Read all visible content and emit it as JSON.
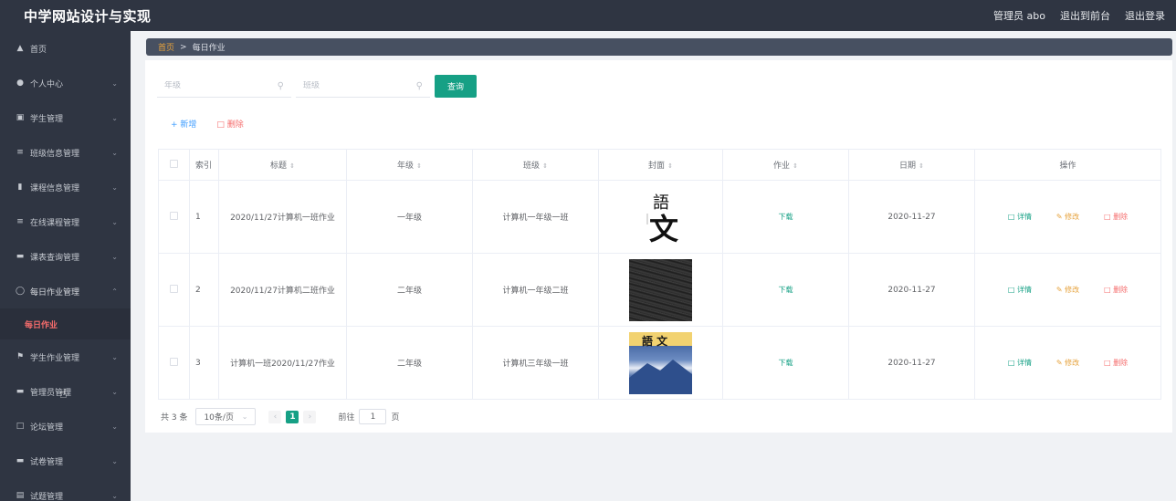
{
  "app": {
    "title": "中学网站设计与实现"
  },
  "header": {
    "user": "管理员 abo",
    "frontend": "退出到前台",
    "logout": "退出登录"
  },
  "sidebar": {
    "items": [
      {
        "label": "首页",
        "icon": "home-icon",
        "expandable": false
      },
      {
        "label": "个人中心",
        "icon": "user-icon",
        "expandable": true
      },
      {
        "label": "学生管理",
        "icon": "idcard-icon",
        "expandable": true
      },
      {
        "label": "班级信息管理",
        "icon": "list-icon",
        "expandable": true
      },
      {
        "label": "课程信息管理",
        "icon": "bar-chart-icon",
        "expandable": true
      },
      {
        "label": "在线课程管理",
        "icon": "sliders-icon",
        "expandable": true
      },
      {
        "label": "课表查询管理",
        "icon": "monitor-icon",
        "expandable": true
      },
      {
        "label": "每日作业管理",
        "icon": "clock-icon",
        "expandable": true,
        "open": true
      },
      {
        "label": "学生作业管理",
        "icon": "flag-icon",
        "expandable": true
      },
      {
        "label": "管理员管理",
        "icon": "monitor-icon",
        "expandable": true
      },
      {
        "label": "论坛管理",
        "icon": "fullscreen-icon",
        "expandable": true
      },
      {
        "label": "试卷管理",
        "icon": "monitor-icon",
        "expandable": true
      },
      {
        "label": "试题管理",
        "icon": "document-icon",
        "expandable": true
      }
    ],
    "active_sub": "每日作业"
  },
  "breadcrumb": {
    "home": "首页",
    "sep": ">",
    "current": "每日作业"
  },
  "filters": {
    "grade_placeholder": "年级",
    "class_placeholder": "班级",
    "query_button": "查询"
  },
  "toolbar": {
    "add": "+ 新增",
    "delete": "删除"
  },
  "table": {
    "columns": [
      "索引",
      "标题",
      "年级",
      "班级",
      "封面",
      "作业",
      "日期",
      "操作"
    ],
    "rows": [
      {
        "index": "1",
        "title": "2020/11/27计算机一班作业",
        "grade": "一年级",
        "class": "计算机一年级一班",
        "cover": "cover-chinese-calligraphy",
        "homework": "下载",
        "date": "2020-11-27"
      },
      {
        "index": "2",
        "title": "2020/11/27计算机二班作业",
        "grade": "二年级",
        "class": "计算机一年级二班",
        "cover": "cover-dark-handwriting",
        "homework": "下载",
        "date": "2020-11-27"
      },
      {
        "index": "3",
        "title": "计算机一班2020/11/27作业",
        "grade": "二年级",
        "class": "计算机三年级一班",
        "cover": "cover-yuwen-mountain",
        "homework": "下载",
        "date": "2020-11-27"
      }
    ],
    "ops": {
      "detail": "详情",
      "edit": "修改",
      "delete": "删除"
    }
  },
  "pagination": {
    "total": "共 3 条",
    "page_size": "10条/页",
    "current_page": "1",
    "goto_prefix": "前往",
    "goto_value": "1",
    "goto_suffix": "页"
  },
  "colors": {
    "topbar": "#2f3542",
    "accent": "#16a085",
    "danger": "#f56c6c",
    "warning": "#e6a23c",
    "primary": "#409eff"
  }
}
